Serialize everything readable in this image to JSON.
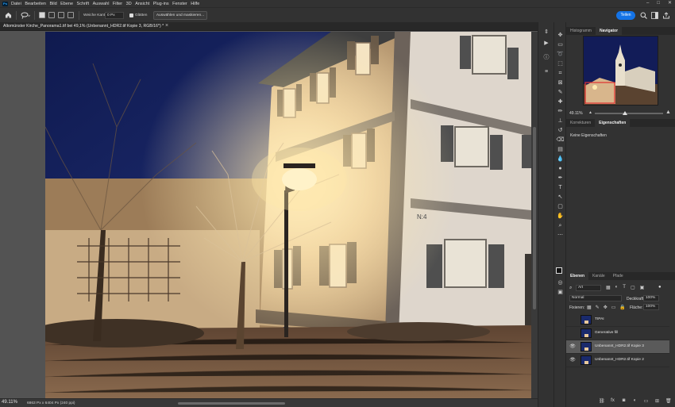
{
  "menubar": {
    "app_icon": "Ps",
    "items": [
      "Datei",
      "Bearbeiten",
      "Bild",
      "Ebene",
      "Schrift",
      "Auswahl",
      "Filter",
      "3D",
      "Ansicht",
      "Plug-ins",
      "Fenster",
      "Hilfe"
    ],
    "window_controls": [
      "–",
      "□",
      "✕"
    ]
  },
  "options_bar": {
    "edge_label": "Weiche Kante:",
    "edge_value": "0 Px",
    "smooth_label": "Glätten",
    "select_mask_label": "Auswählen und maskieren...",
    "share_label": "Teilen"
  },
  "document": {
    "tab_title": "Altomünster Kirche_Panorama1.tif bei 49,1% (Unbenannt_HDR2.tif Kopie 3, RGB/16*) *",
    "close_icon": "×"
  },
  "status": {
    "zoom": "49.11%",
    "info": "6863 Px x 6404 Px (240 ppi)"
  },
  "navigator": {
    "tabs": [
      "Histogramm",
      "Navigator"
    ],
    "active_tab": 1,
    "zoom": "49.11%"
  },
  "properties": {
    "tabs": [
      "Korrekturen",
      "Eigenschaften"
    ],
    "active_tab": 1,
    "empty_text": "Keine Eigenschaften"
  },
  "layers": {
    "tabs": [
      "Ebenen",
      "Kanäle",
      "Pfade"
    ],
    "active_tab": 0,
    "filter_label": "Art",
    "blend_mode": "Normal",
    "opacity_label": "Deckkraft:",
    "opacity_value": "100%",
    "lock_label": "Fixieren:",
    "fill_label": "Fläche:",
    "fill_value": "100%",
    "items": [
      {
        "name": "TIPAI",
        "visible": false,
        "selected": false
      },
      {
        "name": "Generative fill",
        "visible": false,
        "selected": false
      },
      {
        "name": "Unbenannt_HDR2.tif Kopie 3",
        "visible": true,
        "selected": true
      },
      {
        "name": "Unbenannt_HDR2.tif Kopie 2",
        "visible": true,
        "selected": false
      }
    ]
  },
  "colors": {
    "accent": "#1473e6",
    "chrome_dark": "#323232",
    "canvas_sky": "#1c2a6b",
    "lamp_light": "#ffd98a"
  },
  "canvas_sign": "N:4"
}
